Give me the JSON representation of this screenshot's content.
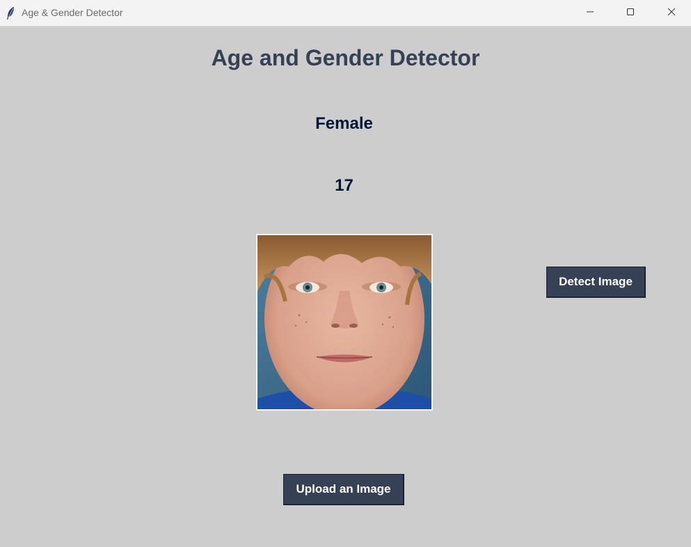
{
  "window": {
    "title": "Age & Gender Detector"
  },
  "main": {
    "heading": "Age and Gender Detector",
    "gender_result": "Female",
    "age_result": "17"
  },
  "buttons": {
    "detect_label": "Detect Image",
    "upload_label": "Upload an Image"
  },
  "icons": {
    "app": "feather-icon",
    "minimize": "minimize-icon",
    "maximize": "maximize-icon",
    "close": "close-icon"
  },
  "colors": {
    "background": "#cdcdcd",
    "heading": "#364156",
    "result_text": "#011638",
    "button_bg": "#364156",
    "button_text": "#ffffff"
  }
}
